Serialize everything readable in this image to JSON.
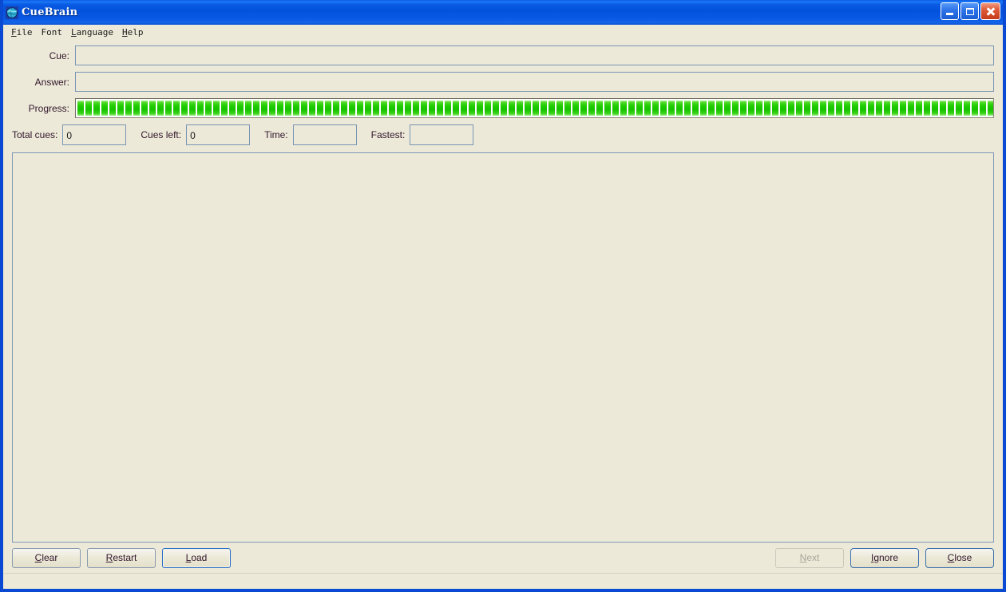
{
  "window": {
    "title": "CueBrain",
    "icon": "globe-icon",
    "controls": {
      "minimize": "minimize-icon",
      "maximize": "maximize-icon",
      "close": "close-icon"
    }
  },
  "menubar": {
    "items": [
      {
        "label": "File",
        "mnemonic": "F"
      },
      {
        "label": "Font",
        "mnemonic": ""
      },
      {
        "label": "Language",
        "mnemonic": "L"
      },
      {
        "label": "Help",
        "mnemonic": "H"
      }
    ]
  },
  "form": {
    "cue": {
      "label": "Cue:",
      "value": "",
      "placeholder": ""
    },
    "answer": {
      "label": "Answer:",
      "value": "",
      "placeholder": ""
    },
    "progress": {
      "label": "Progress:",
      "percent": 100,
      "segments": 115,
      "color": "#1fcc00"
    }
  },
  "counters": {
    "total_cues": {
      "label": "Total cues:",
      "value": "0"
    },
    "cues_left": {
      "label": "Cues left:",
      "value": "0"
    },
    "time": {
      "label": "Time:",
      "value": ""
    },
    "fastest": {
      "label": "Fastest:",
      "value": ""
    }
  },
  "content": {
    "text": ""
  },
  "buttons": {
    "left": [
      {
        "label": "Clear",
        "mnemonic": "C",
        "state": "normal"
      },
      {
        "label": "Restart",
        "mnemonic": "R",
        "state": "normal"
      },
      {
        "label": "Load",
        "mnemonic": "L",
        "state": "default"
      }
    ],
    "right": [
      {
        "label": "Next",
        "mnemonic": "N",
        "state": "disabled"
      },
      {
        "label": "Ignore",
        "mnemonic": "I",
        "state": "accent"
      },
      {
        "label": "Close",
        "mnemonic": "C",
        "state": "accent"
      }
    ]
  },
  "statusbar": {
    "text": ""
  },
  "colors": {
    "titlebar": "#0a52dc",
    "window_frame": "#0a49d2",
    "background": "#ECE9D8",
    "label_text": "#32172c",
    "field_border": "#7a95b5",
    "progress_green": "#1fcc00"
  }
}
